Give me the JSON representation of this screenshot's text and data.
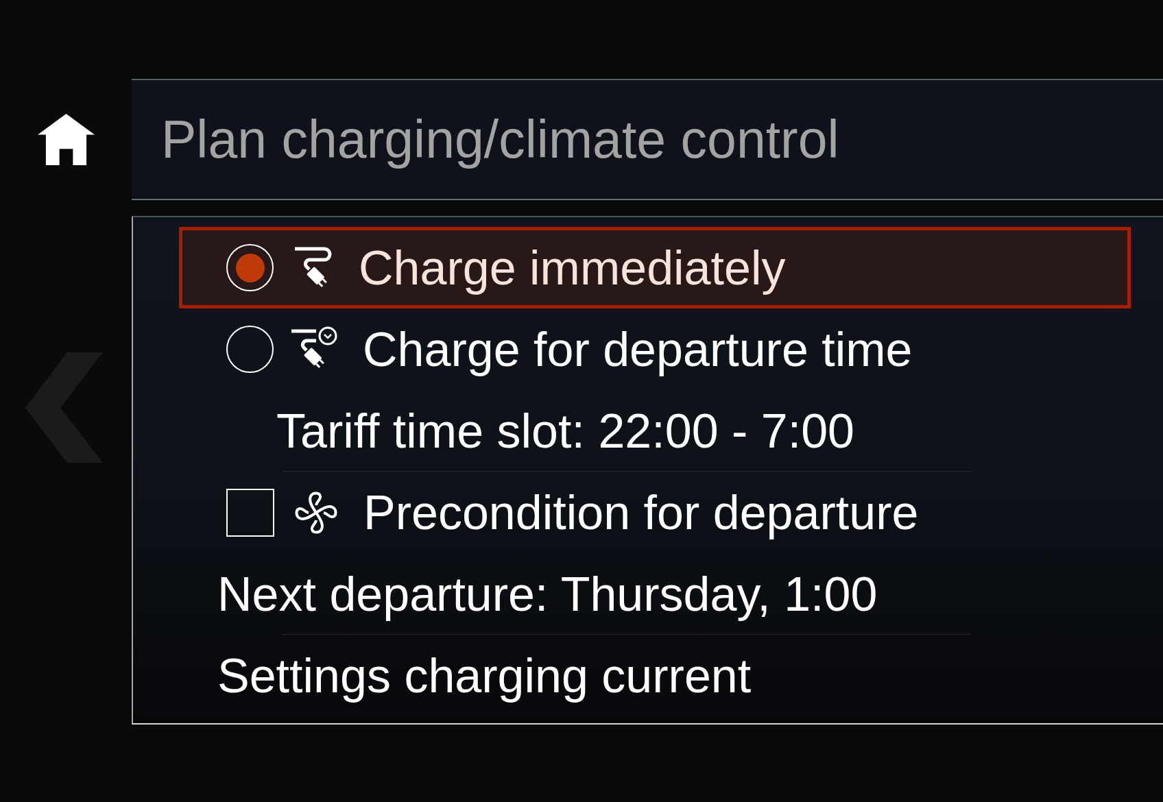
{
  "header": {
    "title": "Plan charging/climate control"
  },
  "menu": {
    "items": [
      {
        "kind": "radio",
        "label": "Charge immediately",
        "selected": true,
        "focused": true
      },
      {
        "kind": "radio",
        "label": "Charge for departure time",
        "selected": false,
        "focused": false
      },
      {
        "kind": "detail",
        "label": "Tariff time slot: 22:00 - 7:00",
        "focused": false
      },
      {
        "kind": "checkbox",
        "label": "Precondition for departure",
        "checked": false,
        "focused": false
      },
      {
        "kind": "info",
        "label": "Next departure: Thursday, 1:00",
        "focused": false
      },
      {
        "kind": "action",
        "label": "Settings charging current",
        "focused": false
      }
    ]
  }
}
